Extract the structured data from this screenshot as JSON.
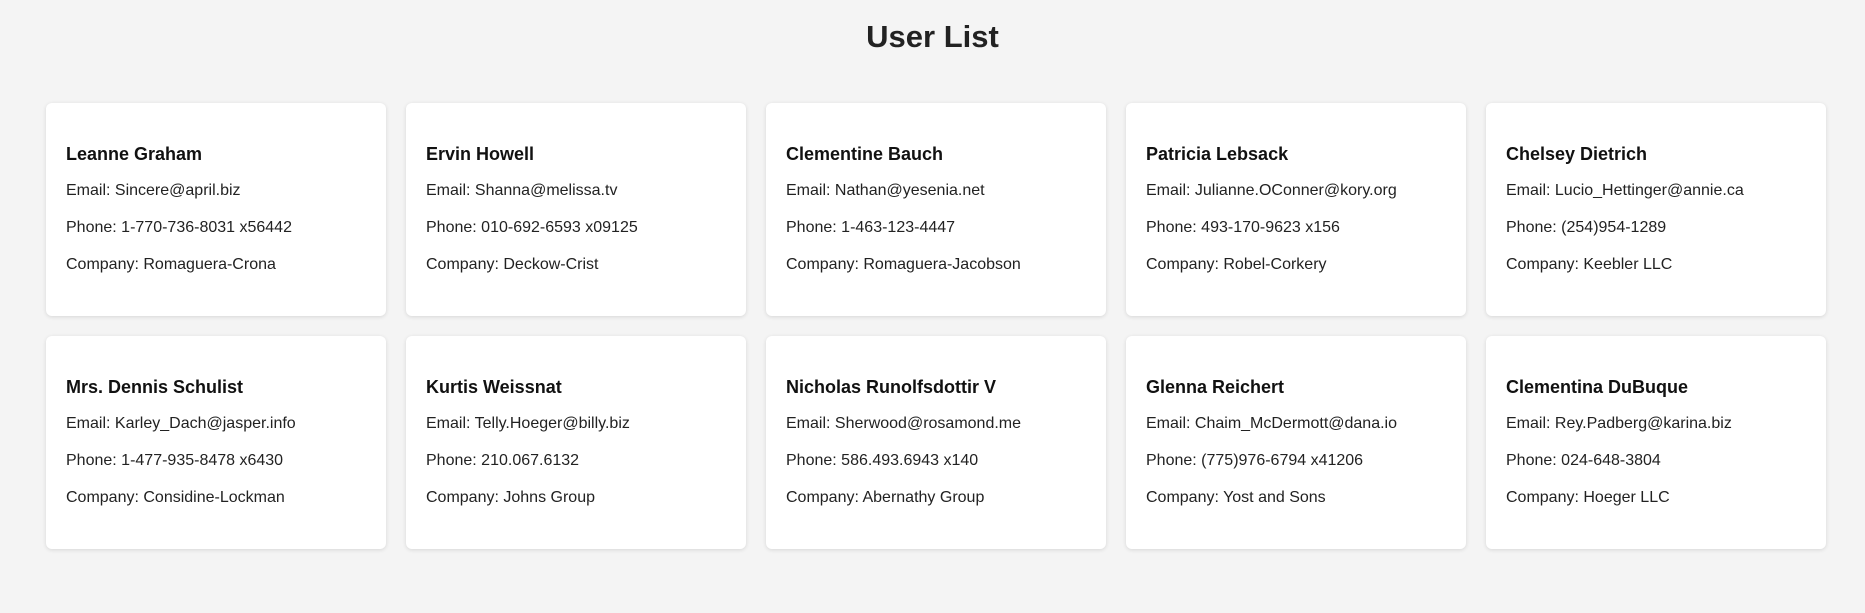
{
  "page": {
    "title": "User List"
  },
  "labels": {
    "email": "Email:",
    "phone": "Phone:",
    "company": "Company:"
  },
  "users": [
    {
      "name": "Leanne Graham",
      "email": "Sincere@april.biz",
      "phone": "1-770-736-8031 x56442",
      "company": "Romaguera-Crona"
    },
    {
      "name": "Ervin Howell",
      "email": "Shanna@melissa.tv",
      "phone": "010-692-6593 x09125",
      "company": "Deckow-Crist"
    },
    {
      "name": "Clementine Bauch",
      "email": "Nathan@yesenia.net",
      "phone": "1-463-123-4447",
      "company": "Romaguera-Jacobson"
    },
    {
      "name": "Patricia Lebsack",
      "email": "Julianne.OConner@kory.org",
      "phone": "493-170-9623 x156",
      "company": "Robel-Corkery"
    },
    {
      "name": "Chelsey Dietrich",
      "email": "Lucio_Hettinger@annie.ca",
      "phone": "(254)954-1289",
      "company": "Keebler LLC"
    },
    {
      "name": "Mrs. Dennis Schulist",
      "email": "Karley_Dach@jasper.info",
      "phone": "1-477-935-8478 x6430",
      "company": "Considine-Lockman"
    },
    {
      "name": "Kurtis Weissnat",
      "email": "Telly.Hoeger@billy.biz",
      "phone": "210.067.6132",
      "company": "Johns Group"
    },
    {
      "name": "Nicholas Runolfsdottir V",
      "email": "Sherwood@rosamond.me",
      "phone": "586.493.6943 x140",
      "company": "Abernathy Group"
    },
    {
      "name": "Glenna Reichert",
      "email": "Chaim_McDermott@dana.io",
      "phone": "(775)976-6794 x41206",
      "company": "Yost and Sons"
    },
    {
      "name": "Clementina DuBuque",
      "email": "Rey.Padberg@karina.biz",
      "phone": "024-648-3804",
      "company": "Hoeger LLC"
    }
  ]
}
